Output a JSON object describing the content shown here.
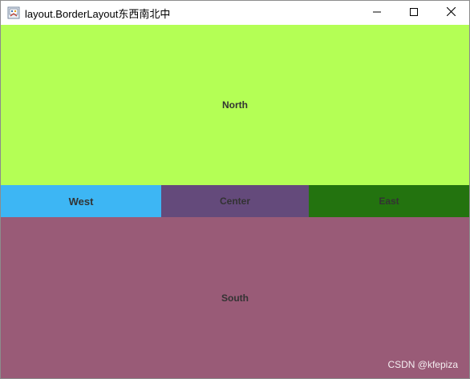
{
  "window": {
    "title": "layout.BorderLayout东西南北中",
    "controls": [
      "minimize-icon",
      "maximize-icon",
      "close-icon"
    ]
  },
  "regions": {
    "north": {
      "label": "North",
      "color": "#b4ff55"
    },
    "west": {
      "label": "West",
      "color": "#3db6f4"
    },
    "center": {
      "label": "Center",
      "color": "#644a7b"
    },
    "east": {
      "label": "East",
      "color": "#23730f"
    },
    "south": {
      "label": "South",
      "color": "#995b77"
    }
  },
  "watermark": "CSDN @kfepiza"
}
